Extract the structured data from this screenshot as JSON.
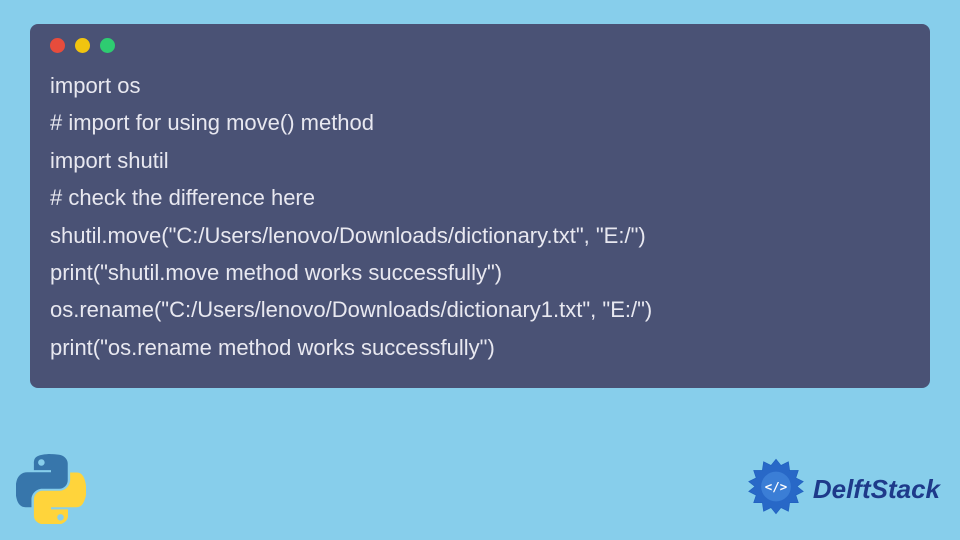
{
  "code": {
    "lines": [
      "import os",
      "# import for using move() method",
      "import shutil",
      "# check the difference here",
      "shutil.move(\"C:/Users/lenovo/Downloads/dictionary.txt\", \"E:/\")",
      "print(\"shutil.move method works successfully\")",
      "os.rename(\"C:/Users/lenovo/Downloads/dictionary1.txt\", \"E:/\")",
      "print(\"os.rename method works successfully\")"
    ]
  },
  "brand": {
    "name": "DelftStack"
  },
  "colors": {
    "page_bg": "#87ceeb",
    "window_bg": "#4a5275",
    "code_text": "#e8e8f0",
    "brand_text": "#1e3a8a",
    "tl_red": "#e74c3c",
    "tl_yellow": "#f1c40f",
    "tl_green": "#2ecc71"
  }
}
